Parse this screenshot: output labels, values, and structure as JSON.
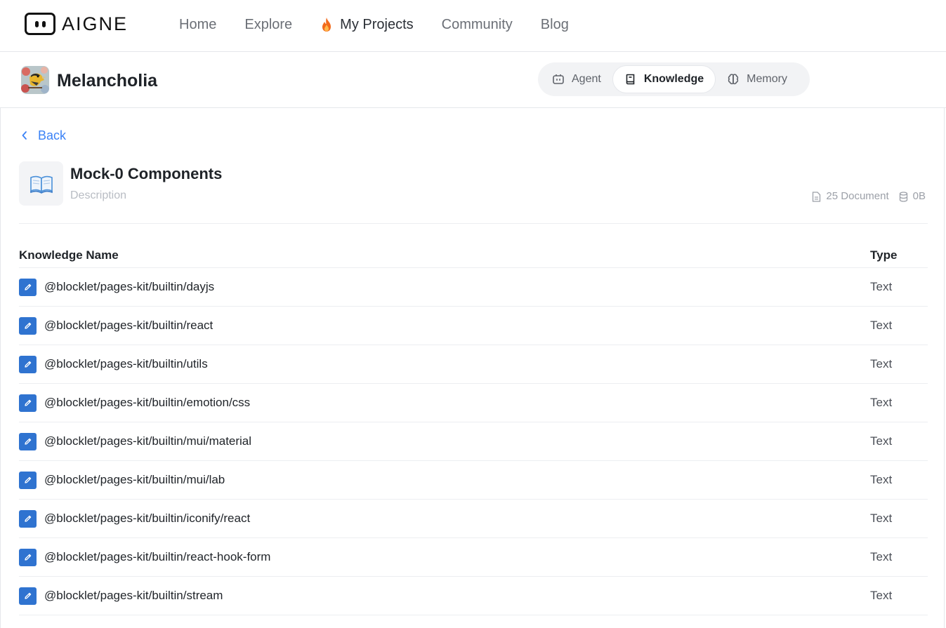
{
  "brand": {
    "name": "AIGNE"
  },
  "nav": {
    "items": [
      {
        "label": "Home"
      },
      {
        "label": "Explore"
      },
      {
        "label": "My Projects",
        "icon": "flame-icon"
      },
      {
        "label": "Community"
      },
      {
        "label": "Blog"
      }
    ]
  },
  "project": {
    "name": "Melancholia",
    "tabs": [
      {
        "label": "Agent",
        "icon": "agent-icon"
      },
      {
        "label": "Knowledge",
        "icon": "book-icon",
        "active": true
      },
      {
        "label": "Memory",
        "icon": "brain-icon"
      }
    ]
  },
  "back_label": "Back",
  "knowledge": {
    "icon": "open-book-icon",
    "title": "Mock-0 Components",
    "description": "Description",
    "doc_count": "25 Document",
    "size": "0B"
  },
  "table": {
    "headers": {
      "name": "Knowledge Name",
      "type": "Type"
    },
    "rows": [
      {
        "name": "@blocklet/pages-kit/builtin/dayjs",
        "type": "Text"
      },
      {
        "name": "@blocklet/pages-kit/builtin/react",
        "type": "Text"
      },
      {
        "name": "@blocklet/pages-kit/builtin/utils",
        "type": "Text"
      },
      {
        "name": "@blocklet/pages-kit/builtin/emotion/css",
        "type": "Text"
      },
      {
        "name": "@blocklet/pages-kit/builtin/mui/material",
        "type": "Text"
      },
      {
        "name": "@blocklet/pages-kit/builtin/mui/lab",
        "type": "Text"
      },
      {
        "name": "@blocklet/pages-kit/builtin/iconify/react",
        "type": "Text"
      },
      {
        "name": "@blocklet/pages-kit/builtin/react-hook-form",
        "type": "Text"
      },
      {
        "name": "@blocklet/pages-kit/builtin/stream",
        "type": "Text"
      }
    ]
  },
  "colors": {
    "accent": "#3b82f6",
    "edit_icon_bg": "#2f73d0"
  }
}
